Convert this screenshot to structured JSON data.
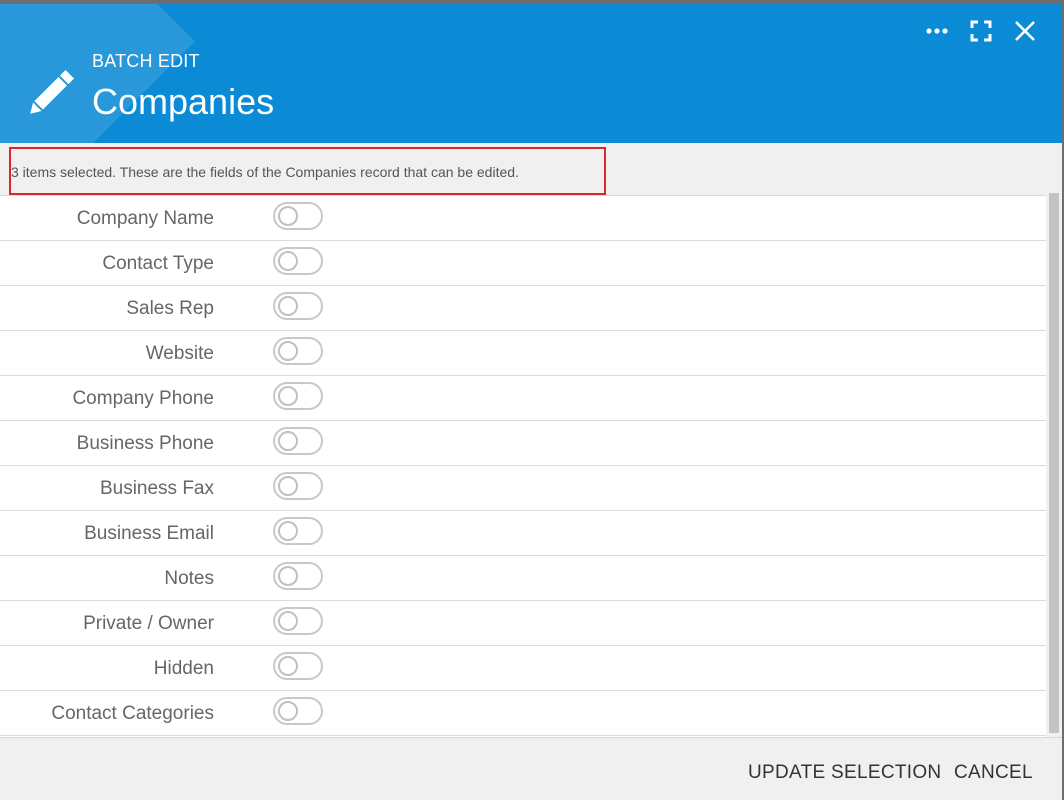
{
  "header": {
    "subtitle": "BATCH EDIT",
    "title": "Companies",
    "icons": {
      "main": "pencil-icon",
      "more": "more-options-icon",
      "maximize": "maximize-icon",
      "close": "close-icon"
    },
    "color": "#0b8ad6"
  },
  "info": {
    "text": "3 items selected. These are the fields of the Companies record that can be edited.",
    "highlight_color": "#d9262e"
  },
  "fields": [
    {
      "label": "Company Name",
      "enabled": false
    },
    {
      "label": "Contact Type",
      "enabled": false
    },
    {
      "label": "Sales Rep",
      "enabled": false
    },
    {
      "label": "Website",
      "enabled": false
    },
    {
      "label": "Company Phone",
      "enabled": false
    },
    {
      "label": "Business Phone",
      "enabled": false
    },
    {
      "label": "Business Fax",
      "enabled": false
    },
    {
      "label": "Business Email",
      "enabled": false
    },
    {
      "label": "Notes",
      "enabled": false
    },
    {
      "label": "Private / Owner",
      "enabled": false
    },
    {
      "label": "Hidden",
      "enabled": false
    },
    {
      "label": "Contact Categories",
      "enabled": false
    }
  ],
  "footer": {
    "update_label": "UPDATE SELECTION",
    "cancel_label": "CANCEL"
  }
}
